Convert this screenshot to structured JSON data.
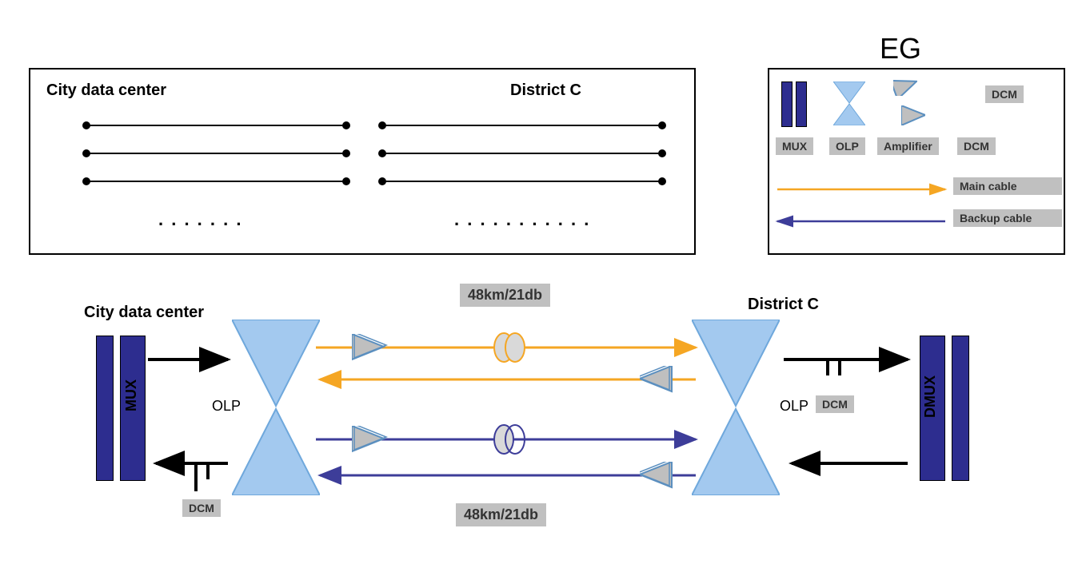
{
  "top_box": {
    "left_label": "City data center",
    "right_label": "District  C",
    "left_dots": ". . . . . . .",
    "right_dots": ". . . . . . . . . . ."
  },
  "legend": {
    "title": "EG",
    "mux": "MUX",
    "olp": "OLP",
    "amplifier": "Amplifier",
    "dcm1": "DCM",
    "dcm2": "DCM",
    "main_cable": "Main cable",
    "backup_cable": "Backup cable"
  },
  "diagram": {
    "left_label": "City data center",
    "right_label": "District C",
    "mux_label": "MUX",
    "dmux_label": "DMUX",
    "olp_left": "OLP",
    "olp_right": "OLP",
    "dcm_left": "DCM",
    "dcm_right": "DCM",
    "dist_top": "48km/21db",
    "dist_bottom": "48km/21db"
  },
  "colors": {
    "main": "#f5a623",
    "backup": "#3d3d99",
    "olp_fill": "#a3c9ef",
    "amp_fill": "#bfbfbf",
    "mux_fill": "#2d2d8f"
  }
}
